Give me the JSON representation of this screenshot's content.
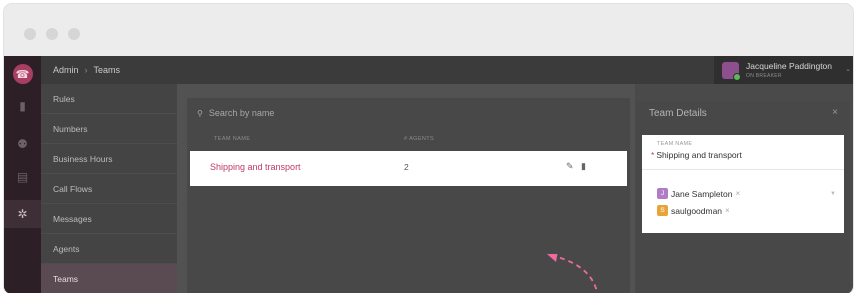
{
  "rail": {
    "items": [
      {
        "name": "phone-icon",
        "glyph": "☎",
        "active": false,
        "logo": true
      },
      {
        "name": "microphone-icon",
        "glyph": "▮",
        "active": false
      },
      {
        "name": "users-icon",
        "glyph": "⚉",
        "active": false
      },
      {
        "name": "list-icon",
        "glyph": "▤",
        "active": false
      },
      {
        "name": "gear-icon",
        "glyph": "✲",
        "active": true
      }
    ]
  },
  "breadcrumb": {
    "root": "Admin",
    "separator": "›",
    "current": "Teams"
  },
  "user": {
    "name": "Jacqueline Paddington",
    "status": "ON BREAKER",
    "chevron": "⌄"
  },
  "sidebar": {
    "items": [
      {
        "label": "Rules"
      },
      {
        "label": "Numbers"
      },
      {
        "label": "Business Hours"
      },
      {
        "label": "Call Flows"
      },
      {
        "label": "Messages"
      },
      {
        "label": "Agents"
      },
      {
        "label": "Teams"
      }
    ],
    "active_index": 6
  },
  "teams": {
    "search_placeholder": "Search by name",
    "search_icon": "⚲",
    "columns": {
      "name": "TEAM NAME",
      "agents": "# AGENTS"
    },
    "rows": [
      {
        "name": "Shipping and transport",
        "agents": "2",
        "edit_icon": "✎",
        "delete_icon": "▮"
      }
    ]
  },
  "details": {
    "title": "Team Details",
    "close_icon": "×",
    "team_name_label": "TEAM NAME",
    "required_mark": "*",
    "team_name_value": "Shipping and transport",
    "members": [
      {
        "initial": "J",
        "name": "Jane Sampleton",
        "color": "#b07cc6",
        "remove": "×"
      },
      {
        "initial": "S",
        "name": "saulgoodman",
        "color": "#e8a43c",
        "remove": "×"
      }
    ],
    "dropdown_icon": "▼"
  },
  "colors": {
    "accent": "#c2376b",
    "arrow": "#f06aa0"
  }
}
